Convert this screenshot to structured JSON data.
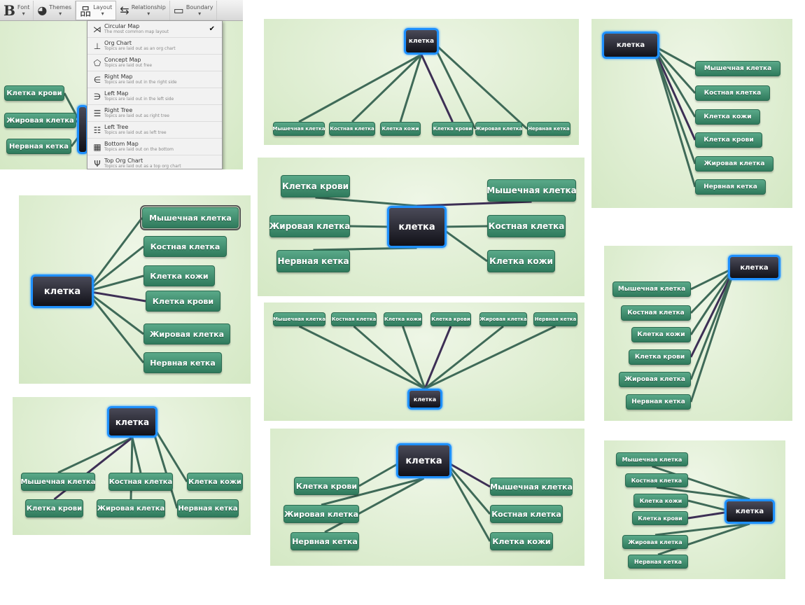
{
  "toolbar": {
    "buttons": [
      {
        "label": "Font",
        "icon": "bold-icon"
      },
      {
        "label": "Themes",
        "icon": "palette-icon"
      },
      {
        "label": "Layout",
        "icon": "org-chart-icon"
      },
      {
        "label": "Relationship",
        "icon": "relationship-icon"
      },
      {
        "label": "Boundary",
        "icon": "boundary-icon"
      }
    ]
  },
  "layout_menu": {
    "checked": "Circular Map",
    "items": [
      {
        "title": "Circular Map",
        "desc": "The most common map layout",
        "icon": "circular-map-icon"
      },
      {
        "title": "Org Chart",
        "desc": "Topics are laid out as an org chart",
        "icon": "org-chart-icon"
      },
      {
        "title": "Concept Map",
        "desc": "Topics are laid out free",
        "icon": "concept-map-icon"
      },
      {
        "title": "Right Map",
        "desc": "Topics are laid out in the right side",
        "icon": "right-map-icon"
      },
      {
        "title": "Left Map",
        "desc": "Topics are laid out in the left side",
        "icon": "left-map-icon"
      },
      {
        "title": "Right Tree",
        "desc": "Topics are laid out as right tree",
        "icon": "right-tree-icon"
      },
      {
        "title": "Left Tree",
        "desc": "Topics are laid out as left tree",
        "icon": "left-tree-icon"
      },
      {
        "title": "Bottom Map",
        "desc": "Topics are laid out on the bottom",
        "icon": "bottom-map-icon"
      },
      {
        "title": "Top Org Chart",
        "desc": "Topics are laid out as a top org chart",
        "icon": "top-org-chart-icon"
      }
    ]
  },
  "colors": {
    "topic": "#3f8f6e",
    "central": "#1a1a22",
    "central_border": "#1e90ff",
    "background": "#dcedcc"
  },
  "panels": [
    {
      "center": "",
      "children": [
        "Клетка крови",
        "Жировая клетка",
        "Нервная кетка"
      ]
    },
    {
      "center": "клетка",
      "children": [
        "Мышечная клетка",
        "Костная клетка",
        "Клетка кожи",
        "Клетка крови",
        "Жировая клетка",
        "Нервная кетка"
      ]
    },
    {
      "center": "клетка",
      "children": [
        "Мышечная клетка",
        "Костная клетка",
        "Клетка кожи",
        "Клетка крови",
        "Жировая клетка",
        "Нервная кетка"
      ]
    },
    {
      "center": "клетка",
      "children": [
        "Клетка крови",
        "Жировая клетка",
        "Нервная кетка",
        "Мышечная клетка",
        "Костная клетка",
        "Клетка кожи"
      ]
    },
    {
      "center": "клетка",
      "children": [
        "Мышечная клетка",
        "Костная клетка",
        "Клетка кожи",
        "Клетка крови",
        "Жировая клетка",
        "Нервная кетка"
      ]
    },
    {
      "center": "клетка",
      "children": [
        "Мышечная клетка",
        "Костная клетка",
        "Клетка кожи",
        "Клетка крови",
        "Жировая клетка",
        "Нервная кетка"
      ]
    },
    {
      "center": "клетка",
      "children": [
        "Мышечная клетка",
        "Костная клетка",
        "Клетка кожи",
        "Клетка крови",
        "Жировая клетка",
        "Нервная кетка"
      ]
    },
    {
      "center": "клетка",
      "children": [
        "Мышечная клетка",
        "Костная клетка",
        "Клетка кожи",
        "Клетка крови",
        "Жировая клетка",
        "Нервная кетка"
      ]
    },
    {
      "center": "клетка",
      "children": [
        "Клетка крови",
        "Жировая клетка",
        "Нервная кетка",
        "Мышечная клетка",
        "Костная клетка",
        "Клетка кожи"
      ]
    },
    {
      "center": "клетка",
      "children": [
        "Мышечная клетка",
        "Костная клетка",
        "Клетка кожи",
        "Клетка крови",
        "Жировая клетка",
        "Нервная кетка"
      ]
    }
  ]
}
